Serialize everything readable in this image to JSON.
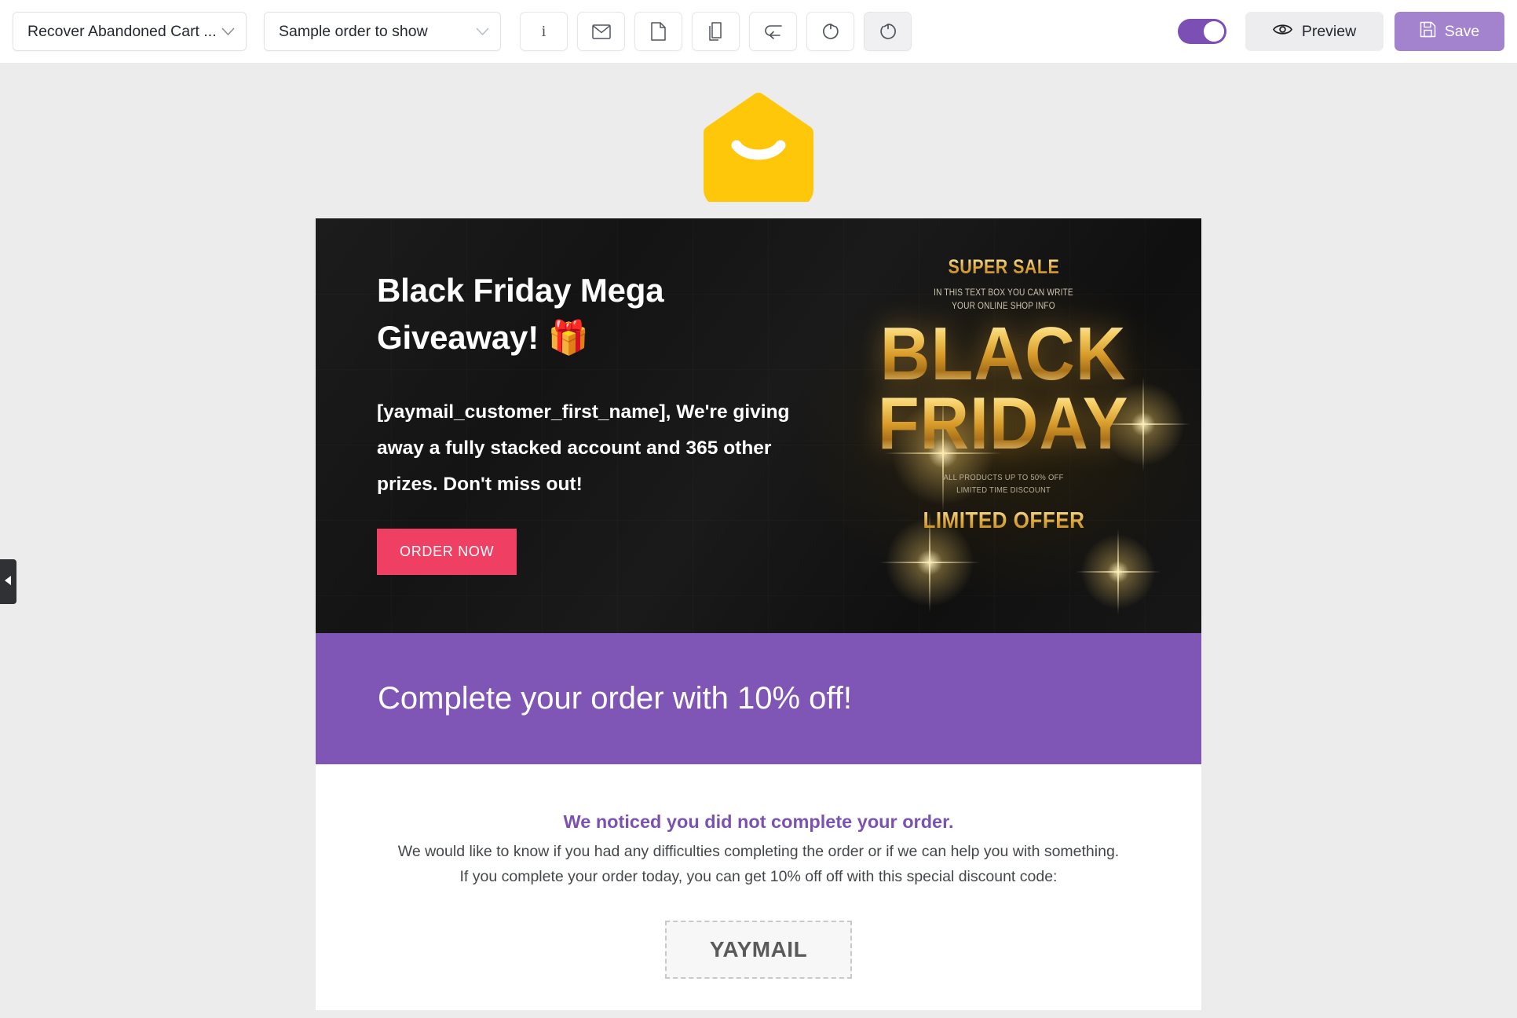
{
  "toolbar": {
    "template_select": {
      "value": "Recover Abandoned Cart ...",
      "icon": "chevron-down-icon"
    },
    "order_select": {
      "value": "Sample order to show",
      "icon": "chevron-down-icon"
    },
    "buttons": [
      {
        "name": "info-icon",
        "title": "Info",
        "glyph": "i"
      },
      {
        "name": "envelope-icon",
        "title": "Email",
        "glyph": "envelope"
      },
      {
        "name": "document-icon",
        "title": "Document",
        "glyph": "page"
      },
      {
        "name": "duplicate-icon",
        "title": "Duplicate",
        "glyph": "copy"
      },
      {
        "name": "undo-arrow-icon",
        "title": "Undo",
        "glyph": "return"
      },
      {
        "name": "reset-ccw-icon",
        "title": "Reset",
        "glyph": "refresh-ccw"
      },
      {
        "name": "reload-cw-icon",
        "title": "Reload",
        "glyph": "refresh-cw"
      }
    ],
    "toggle": {
      "label": "enabled-toggle",
      "state": "on"
    },
    "preview_label": "Preview",
    "save_label": "Save",
    "colors": {
      "toggle_on": "#7b4fb4",
      "save_bg": "#a383cd",
      "preview_bg": "#ededef"
    }
  },
  "side_handle": {
    "name": "collapse-panel-handle",
    "direction": "left"
  },
  "email": {
    "logo": {
      "name": "yaymail-logo",
      "shape": "envelope-smile",
      "color": "#ffc709"
    },
    "hero": {
      "title": "Black Friday Mega Giveaway! 🎁",
      "title_line1": "Black Friday Mega",
      "title_line2": "Giveaway! 🎁",
      "body": "[yaymail_customer_first_name], We're giving away a fully stacked account and 365 other prizes. Don't miss out!",
      "cta_label": "ORDER NOW",
      "cta_color": "#ef4063",
      "artwork": {
        "super_sale": "SUPER SALE",
        "sub_line1": "IN THIS TEXT BOX YOU CAN WRITE",
        "sub_line2": "YOUR ONLINE SHOP INFO",
        "word1": "BLACK",
        "word2": "FRIDAY",
        "foot_line1": "ALL PRODUCTS UP TO 50% OFF",
        "foot_line2": "LIMITED TIME DISCOUNT",
        "limited_offer": "LIMITED OFFER"
      }
    },
    "band": {
      "text": "Complete your order with 10% off!",
      "color": "#7f55b6"
    },
    "content": {
      "heading": "We noticed you did not complete your order.",
      "paragraph1": "We would like to know if you had any difficulties completing the order or if we can help you with something.",
      "paragraph2": "If you complete your order today, you can get 10% off off with this special discount code:",
      "coupon_code": "YAYMAIL",
      "heading_color": "#7b52b0"
    }
  }
}
